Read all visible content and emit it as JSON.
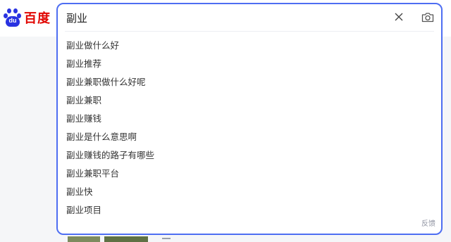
{
  "logo": {
    "mark": "du",
    "text": "百度"
  },
  "search": {
    "value": "副业"
  },
  "suggestions": [
    "副业做什么好",
    "副业推荐",
    "副业兼职做什么好呢",
    "副业兼职",
    "副业赚钱",
    "副业是什么意思啊",
    "副业赚钱的路子有哪些",
    "副业兼职平台",
    "副业快",
    "副业项目"
  ],
  "feedback_label": "反馈",
  "colors": {
    "brand_blue": "#2932e1",
    "brand_red": "#e10602",
    "border": "#4e6ef2"
  },
  "icons": {
    "clear": "close-icon",
    "camera": "camera-icon"
  }
}
